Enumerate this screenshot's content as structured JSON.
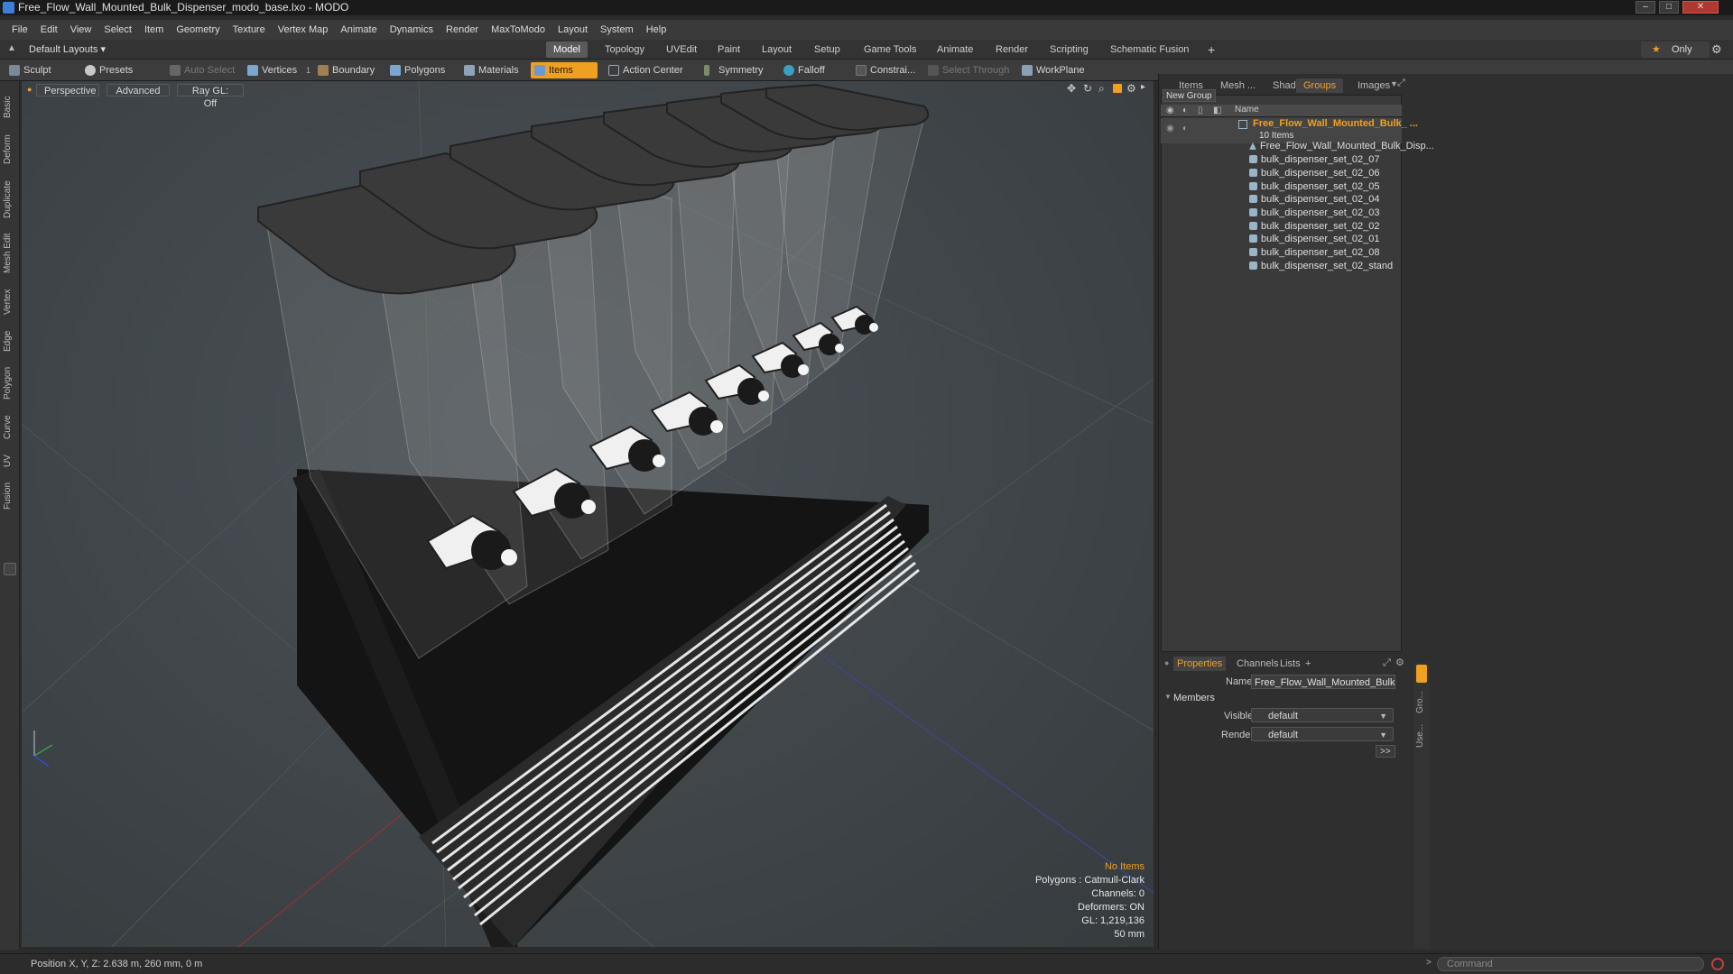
{
  "window": {
    "title": "Free_Flow_Wall_Mounted_Bulk_Dispenser_modo_base.lxo - MODO",
    "controls": [
      "–",
      "□",
      "✕"
    ]
  },
  "menu": [
    "File",
    "Edit",
    "View",
    "Select",
    "Item",
    "Geometry",
    "Texture",
    "Vertex Map",
    "Animate",
    "Dynamics",
    "Render",
    "MaxToModo",
    "Layout",
    "System",
    "Help"
  ],
  "layout_selector": "Default Layouts",
  "mode_tabs": [
    "Model",
    "Topology",
    "UVEdit",
    "Paint",
    "Layout",
    "Setup",
    "Game Tools",
    "Animate",
    "Render",
    "Scripting",
    "Schematic Fusion"
  ],
  "mode_add": "+",
  "only_label": "Only",
  "toolbar": {
    "sculpt": "Sculpt",
    "presets": "Presets",
    "auto_select": "Auto Select",
    "vertices": "Vertices",
    "vertices_count": "1",
    "boundary": "Boundary",
    "polygons": "Polygons",
    "materials": "Materials",
    "items": "Items",
    "action_center": "Action Center",
    "symmetry": "Symmetry",
    "falloff": "Falloff",
    "constraints": "Constrai...",
    "select_through": "Select Through",
    "workplane": "WorkPlane"
  },
  "left_tabs": [
    "Basic",
    "Deform",
    "Duplicate",
    "Mesh Edit",
    "Vertex",
    "Edge",
    "Polygon",
    "Curve",
    "UV",
    "Fusion"
  ],
  "viewport": {
    "view_mode": "Perspective",
    "shading": "Advanced",
    "raygl": "Ray GL: Off",
    "info": {
      "selection": "No Items",
      "polygons": "Polygons : Catmull-Clark",
      "channels": "Channels: 0",
      "deformers": "Deformers: ON",
      "gl": "GL: 1,219,136",
      "scale": "50 mm"
    }
  },
  "panel_tabs": [
    "Items",
    "Mesh ...",
    "Shading",
    "Groups",
    "Images"
  ],
  "groups": {
    "new_group": "New Group",
    "name_header": "Name",
    "root": "Free_Flow_Wall_Mounted_Bulk_ ...",
    "root_count": "10 Items",
    "items": [
      "Free_Flow_Wall_Mounted_Bulk_Disp...",
      "bulk_dispenser_set_02_07",
      "bulk_dispenser_set_02_06",
      "bulk_dispenser_set_02_05",
      "bulk_dispenser_set_02_04",
      "bulk_dispenser_set_02_03",
      "bulk_dispenser_set_02_02",
      "bulk_dispenser_set_02_01",
      "bulk_dispenser_set_02_08",
      "bulk_dispenser_set_02_stand"
    ]
  },
  "properties": {
    "tabs": [
      "Properties",
      "Channels",
      "Lists",
      "+"
    ],
    "name_label": "Name",
    "name_value": "Free_Flow_Wall_Mounted_Bulk_Disper",
    "section": "Members",
    "visible_label": "Visible",
    "visible_value": "default",
    "render_label": "Render",
    "render_value": "default",
    "more": ">>"
  },
  "side_tabs": [
    "Gro...",
    "Use..."
  ],
  "status": {
    "position": "Position X, Y, Z:  2.638 m, 260 mm, 0 m",
    "command_placeholder": "Command"
  },
  "colors": {
    "accent": "#f0a020",
    "viewport_bg": "#41474b"
  }
}
